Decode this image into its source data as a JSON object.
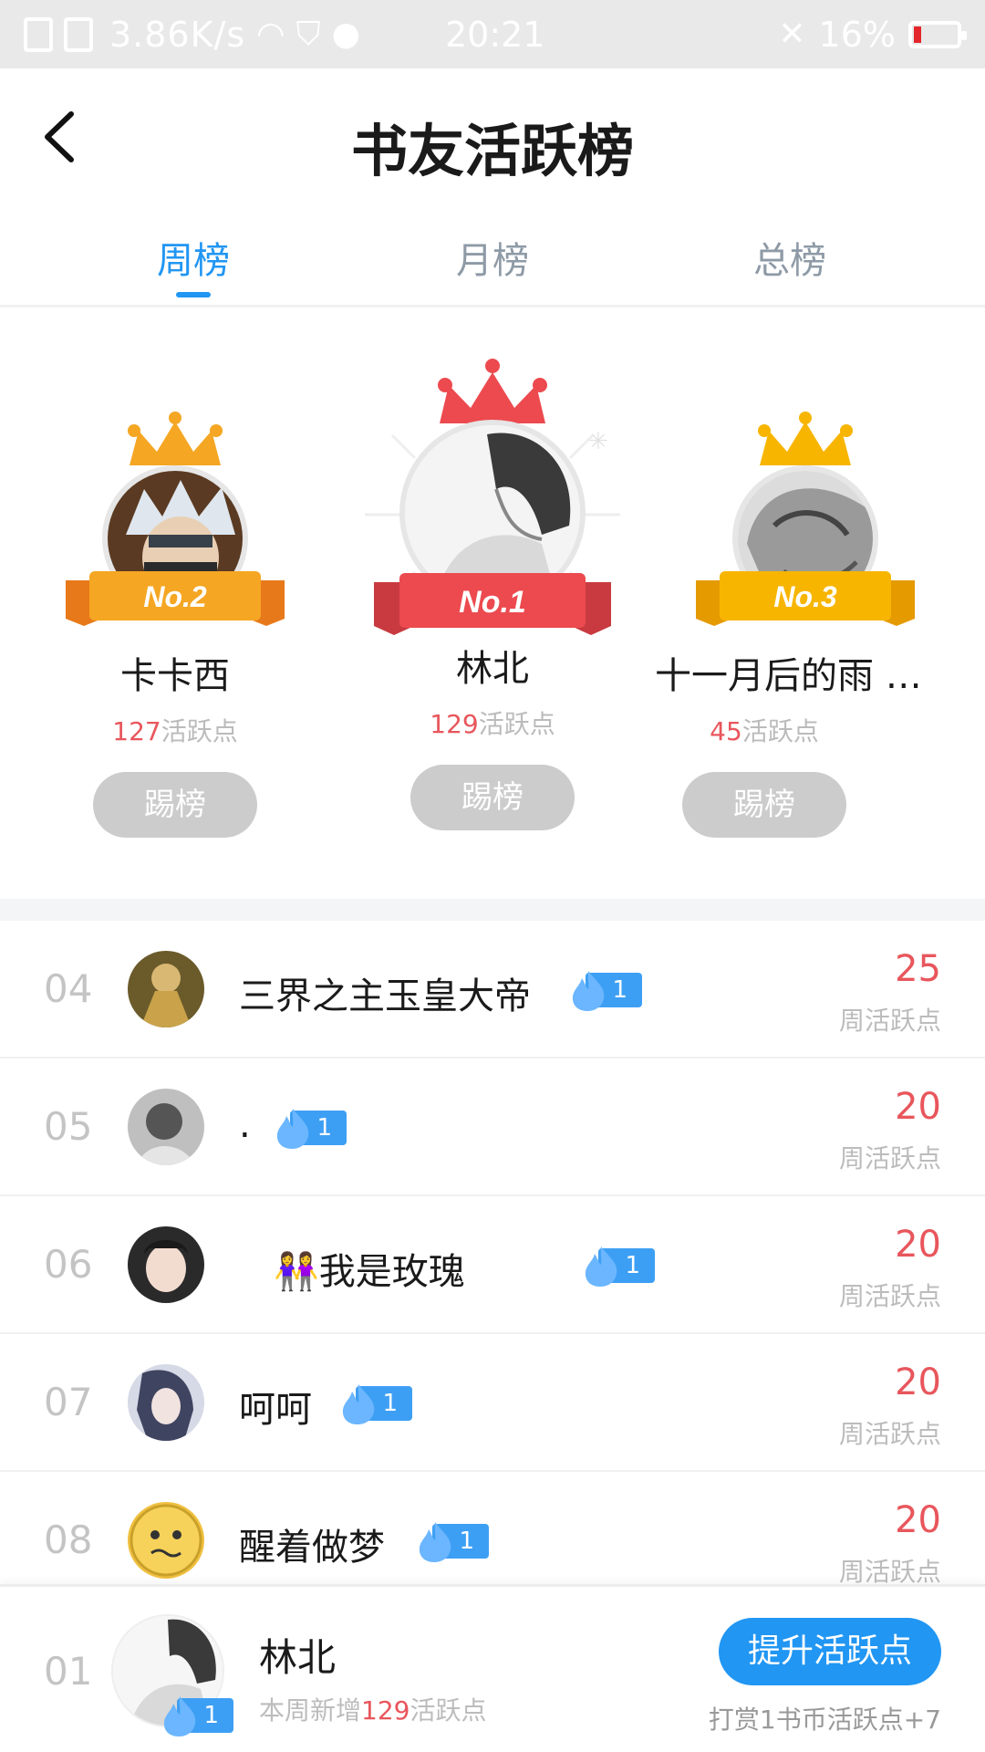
{
  "status_bar": {
    "speed": "3.86K/s",
    "time": "20:21",
    "battery": "16%",
    "battery_level": 0.16
  },
  "header": {
    "title": "书友活跃榜"
  },
  "tabs": [
    {
      "label": "周榜",
      "active": true
    },
    {
      "label": "月榜",
      "active": false
    },
    {
      "label": "总榜",
      "active": false
    }
  ],
  "podium": {
    "first": {
      "rank_label": "No.1",
      "name": "林北",
      "points": "129",
      "points_suffix": "活跃点",
      "button": "踢榜"
    },
    "second": {
      "rank_label": "No.2",
      "name": "卡卡西",
      "points": "127",
      "points_suffix": "活跃点",
      "button": "踢榜"
    },
    "third": {
      "rank_label": "No.3",
      "name": "十一月后的雨 …",
      "points": "45",
      "points_suffix": "活跃点",
      "button": "踢榜"
    }
  },
  "list": [
    {
      "rank": "04",
      "name": "三界之主玉皇大帝",
      "badge": "1",
      "score": "25",
      "score_label": "周活跃点"
    },
    {
      "rank": "05",
      "name": ".",
      "badge": "1",
      "score": "20",
      "score_label": "周活跃点"
    },
    {
      "rank": "06",
      "name": "👭我是玫瑰",
      "badge": "1",
      "score": "20",
      "score_label": "周活跃点"
    },
    {
      "rank": "07",
      "name": "呵呵",
      "badge": "1",
      "score": "20",
      "score_label": "周活跃点"
    },
    {
      "rank": "08",
      "name": "醒着做梦",
      "badge": "1",
      "score": "20",
      "score_label": "周活跃点"
    }
  ],
  "me": {
    "rank": "01",
    "name": "林北",
    "badge": "1",
    "sub_prefix": "本周新增",
    "sub_points": "129",
    "sub_suffix": "活跃点",
    "button": "提升活跃点",
    "hint": "打赏1书币活跃点+7"
  },
  "colors": {
    "accent": "#2196f3",
    "score_red": "#e8565c",
    "gold_crown": "#f7b500",
    "orange_crown": "#f5a623",
    "red_crown": "#ec4a4f"
  }
}
